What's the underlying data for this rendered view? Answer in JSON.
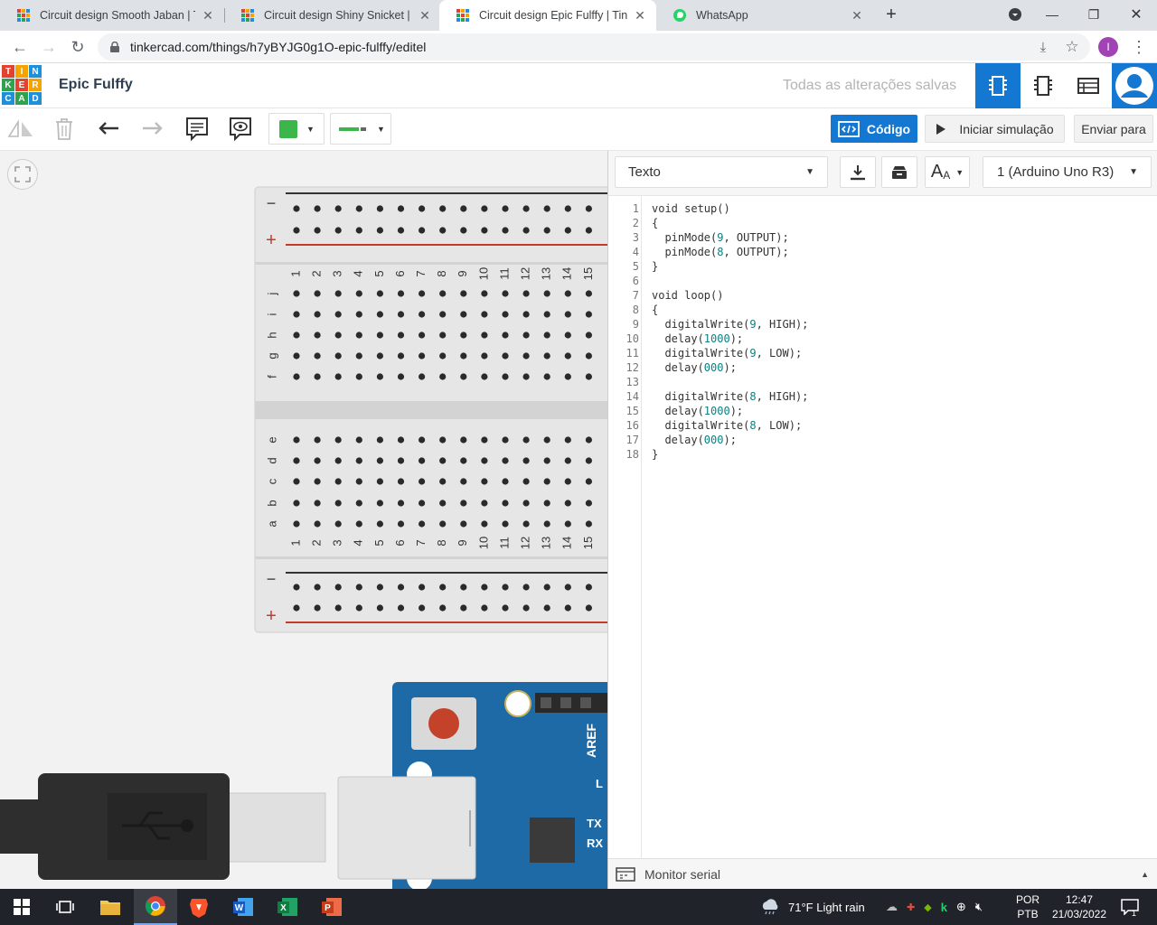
{
  "browser": {
    "tabs": [
      {
        "title": "Circuit design Smooth Jaban | Tinkercad",
        "active": false
      },
      {
        "title": "Circuit design Shiny Snicket | Tinkercad",
        "active": false
      },
      {
        "title": "Circuit design Epic Fulffy | Tinkercad",
        "active": true
      },
      {
        "title": "WhatsApp",
        "active": false
      }
    ],
    "url": "tinkercad.com/things/h7yBYJG0g1O-epic-fulffy/editel",
    "profile_initial": "I"
  },
  "app": {
    "logo_letters": [
      "T",
      "I",
      "N",
      "K",
      "E",
      "R",
      "C",
      "A",
      "D"
    ],
    "logo_colors": [
      "#e3422f",
      "#f6a300",
      "#1e8fdb",
      "#2fa24e",
      "#e3422f",
      "#f6a300",
      "#1e8fdb",
      "#2fa24e",
      "#1e8fdb"
    ],
    "design_title": "Epic Fulffy",
    "save_status": "Todas as alterações salvas"
  },
  "toolbar": {
    "code_label": "Código",
    "simulate_label": "Iniciar simulação",
    "send_label": "Enviar para",
    "fill_color": "#3cb54a",
    "wire_color": "#3cb54a",
    "accent": "#1477d1"
  },
  "breadboard": {
    "columns": [
      "1",
      "2",
      "3",
      "4",
      "5",
      "6",
      "7",
      "8",
      "9",
      "10",
      "11",
      "12",
      "13",
      "14",
      "15"
    ],
    "upper_rows": [
      "j",
      "i",
      "h",
      "g",
      "f"
    ],
    "lower_rows": [
      "e",
      "d",
      "c",
      "b",
      "a"
    ],
    "rail_minus": "−",
    "rail_plus": "+"
  },
  "arduino": {
    "aref_label": "AREF",
    "l_label": "L",
    "tx_label": "TX",
    "rx_label": "RX"
  },
  "code_panel": {
    "mode": "Texto",
    "component": "1 (Arduino Uno R3)",
    "lines": [
      "void setup()",
      "{",
      "  pinMode(9, OUTPUT);",
      "  pinMode(8, OUTPUT);",
      "}",
      "",
      "void loop()",
      "{",
      "  digitalWrite(9, HIGH);",
      "  delay(1000);",
      "  digitalWrite(9, LOW);",
      "  delay(000);",
      "",
      "  digitalWrite(8, HIGH);",
      "  delay(1000);",
      "  digitalWrite(8, LOW);",
      "  delay(000);",
      "}"
    ],
    "serial_monitor_label": "Monitor serial"
  },
  "taskbar": {
    "weather": "71°F  Light rain",
    "lang_top": "POR",
    "lang_bottom": "PTB",
    "time": "12:47",
    "date": "21/03/2022",
    "notification_count": "1"
  }
}
